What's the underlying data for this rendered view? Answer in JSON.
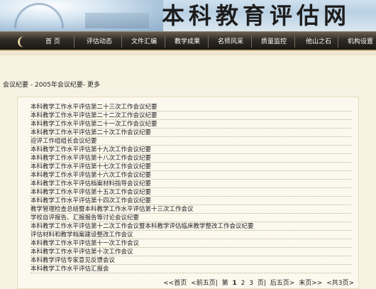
{
  "site": {
    "title": "本科教育评估网"
  },
  "nav": {
    "items": [
      "首 页",
      "评估动态",
      "文件汇编",
      "教学成果",
      "名师风采",
      "质量监控",
      "他山之石",
      "机构设置"
    ]
  },
  "breadcrumb": {
    "part1": "会议纪要",
    "sep1": " - ",
    "part2": "2005年会议纪要",
    "sep2": "-",
    "more": "更多"
  },
  "list": [
    "本科教学工作水平评估第二十三次工作会议纪要",
    "本科教学工作水平评估第二十二次工作会议纪要",
    "本科教学工作水平评估第二十一次工作会议纪要",
    "本科教学工作水平评估第二十次工作会议纪要",
    "迎评工作组组长会议纪要",
    "本科教学工作水平评估第十九次工作会议纪要",
    "本科教学工作水平评估第十八次工作会议纪要",
    "本科教学工作水平评估第十七次工作会议纪要",
    "本科教学工作水平评估第十六次工作会议纪要",
    "本科教学工作水平评估档案材料指导会议纪要",
    "本科教学工作水平评估第十五次工作会议纪要",
    "本科教学工作水平评估第十四次工作会议纪要",
    "教学管理检查总结暨本科教学工作水平评估第十三次工作会议",
    "学校自评报告、汇报报告等讨论会议纪要",
    "本科教学工作水平评估第十二次工作会议暨本科教学评估临床教学整改工作会议纪要",
    "评估材料和教学档案建设整改工作会议",
    "本科教学工作水平评估第十一次工作会议",
    "本科教学工作水平评估第十次工作会议",
    "本科教学评估专家意见反馈会议",
    "本科教学工作水平评估汇报会"
  ],
  "pager": {
    "first": "<<首页",
    "prev": "<前五页|",
    "page_prefix": "第",
    "current": "1",
    "p2": "2",
    "p3": "3",
    "page_suffix": "页|",
    "next": "后五页>",
    "last": "末页>>",
    "total": "<共3页>"
  }
}
